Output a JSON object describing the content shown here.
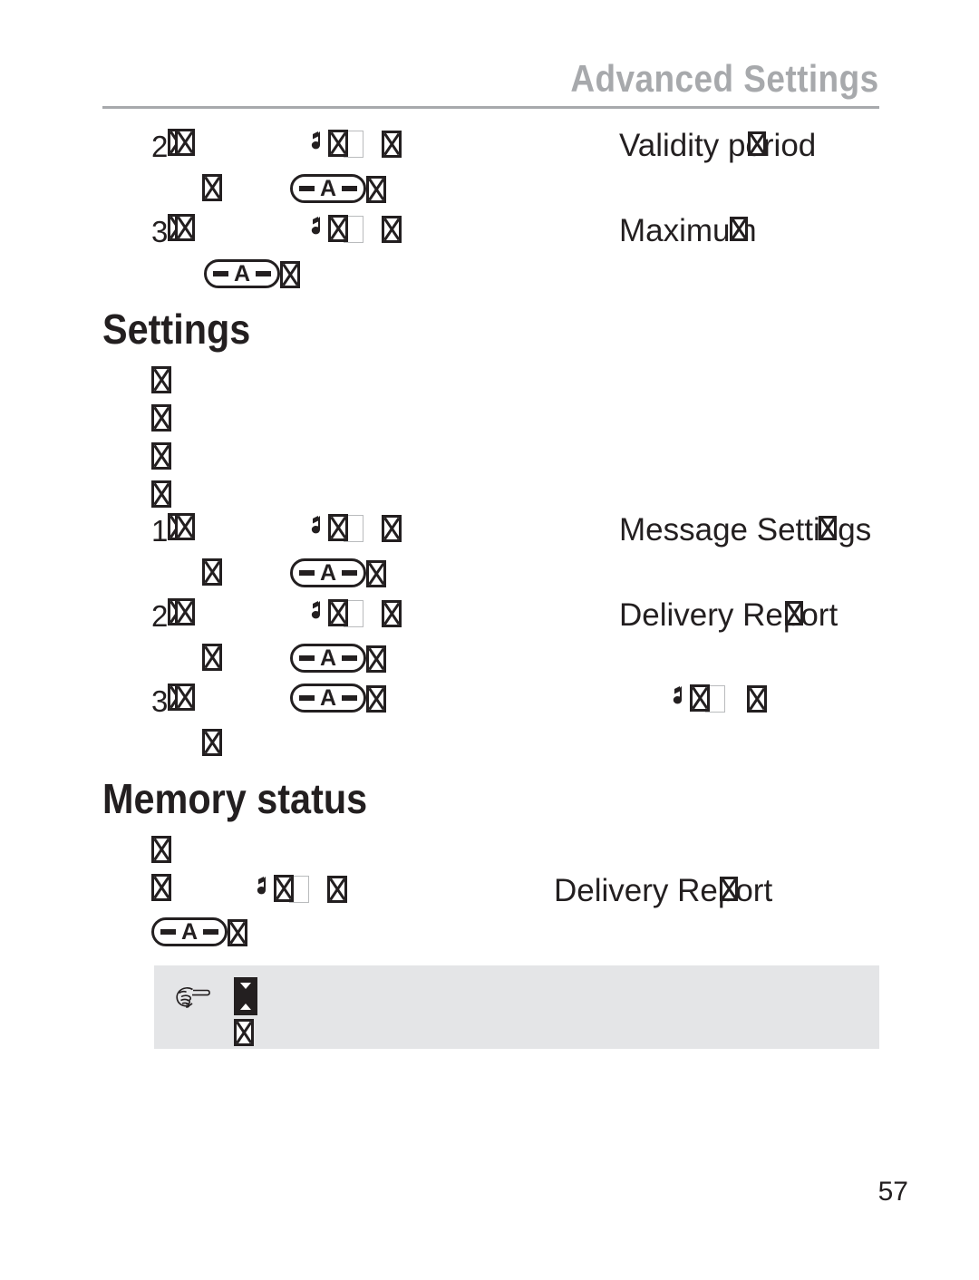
{
  "page": {
    "number": "57",
    "running_header": "Advanced Settings"
  },
  "headings": {
    "settings": "Settings",
    "memory_status": "Memory status"
  },
  "steps": {
    "top": [
      {
        "number": "2",
        "label": "Validity period"
      },
      {
        "number": "3",
        "label": "Maximum"
      }
    ],
    "middle": [
      {
        "number": "1",
        "label": "Message Settings"
      },
      {
        "number": "2",
        "label": "Delivery Report"
      },
      {
        "number": "3",
        "label": ""
      }
    ],
    "bottom": [
      {
        "number": "",
        "label": "Delivery Report"
      }
    ]
  },
  "icons": {
    "key_a_letter": "A",
    "music_note": "music-note-icon",
    "key_button": "minus-a-minus-key-icon",
    "pointing_hand": "pointing-hand-icon",
    "arrow_key": "up-down-arrow-key-icon",
    "missing_glyph": "missing-glyph-box"
  },
  "colors": {
    "header_gray": "#a7a9ac",
    "text": "#231f20",
    "note_background": "#e4e5e7",
    "box_outline": "#b9bbbd"
  }
}
